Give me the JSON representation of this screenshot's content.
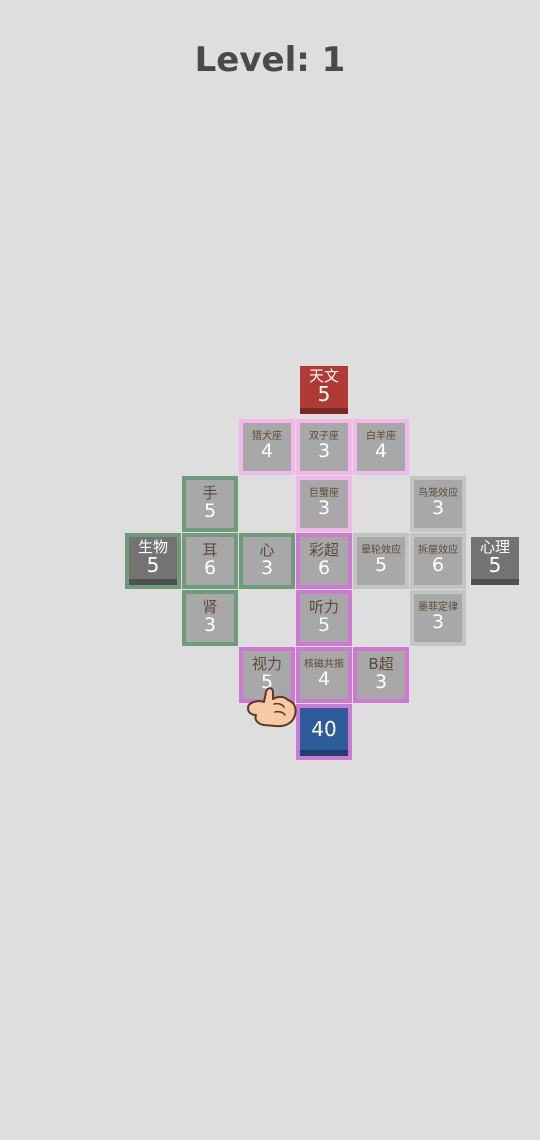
{
  "level_title": "Level: 1",
  "colors": {
    "background": "#dedede",
    "cell": "#a8a8a8",
    "astronomy": "#b03a36",
    "biology": "#737373",
    "psychology": "#737373",
    "player": "#2e5c9a",
    "pink_group": "#f2b8ea",
    "green_group": "#6f9a7c",
    "purple_group": "#cc7ad2",
    "grey_group": "#c4c4c4"
  },
  "frames": [
    {
      "id": "astronomy-zone",
      "color": "#f2b8ea",
      "cells": [
        [
          4,
          1
        ],
        [
          5,
          1
        ],
        [
          6,
          1
        ],
        [
          5,
          2
        ]
      ]
    },
    {
      "id": "biology-zone",
      "color": "#6f9a7c",
      "cells": [
        [
          3,
          2
        ],
        [
          2,
          3
        ],
        [
          3,
          3
        ],
        [
          4,
          3
        ],
        [
          3,
          4
        ]
      ]
    },
    {
      "id": "psychology-zone",
      "color": "#c4c4c4",
      "cells": [
        [
          7,
          2
        ],
        [
          6,
          3
        ],
        [
          7,
          3
        ],
        [
          7,
          4
        ]
      ]
    },
    {
      "id": "physics-zone",
      "color": "#cc7ad2",
      "cells": [
        [
          5,
          3
        ],
        [
          5,
          4
        ],
        [
          4,
          5
        ],
        [
          5,
          5
        ],
        [
          6,
          5
        ],
        [
          5,
          6
        ]
      ]
    }
  ],
  "categories": [
    {
      "id": "astronomy",
      "label": "天文",
      "value": "5",
      "col": 5,
      "row": 0,
      "color": "#b03a36"
    },
    {
      "id": "biology",
      "label": "生物",
      "value": "5",
      "col": 2,
      "row": 3,
      "color": "#737373"
    },
    {
      "id": "psychology",
      "label": "心理",
      "value": "5",
      "col": 8,
      "row": 3,
      "color": "#737373"
    }
  ],
  "cells": [
    {
      "id": "orion",
      "label": "猎犬座",
      "value": "4",
      "col": 4,
      "row": 1,
      "small": true
    },
    {
      "id": "gemini",
      "label": "双子座",
      "value": "3",
      "col": 5,
      "row": 1,
      "small": true
    },
    {
      "id": "aries",
      "label": "白羊座",
      "value": "4",
      "col": 6,
      "row": 1,
      "small": true
    },
    {
      "id": "hand",
      "label": "手",
      "value": "5",
      "col": 3,
      "row": 2
    },
    {
      "id": "cancer",
      "label": "巨蟹座",
      "value": "3",
      "col": 5,
      "row": 2,
      "small": true
    },
    {
      "id": "birdcage",
      "label": "鸟笼效应",
      "value": "3",
      "col": 7,
      "row": 2,
      "small": true
    },
    {
      "id": "ear",
      "label": "耳",
      "value": "6",
      "col": 3,
      "row": 3
    },
    {
      "id": "heart",
      "label": "心",
      "value": "3",
      "col": 4,
      "row": 3
    },
    {
      "id": "color-doppler",
      "label": "彩超",
      "value": "6",
      "col": 5,
      "row": 3
    },
    {
      "id": "halo-effect",
      "label": "晕轮效应",
      "value": "5",
      "col": 6,
      "row": 3,
      "small": true
    },
    {
      "id": "broken-window",
      "label": "拆屋效应",
      "value": "6",
      "col": 7,
      "row": 3,
      "small": true
    },
    {
      "id": "kidney",
      "label": "肾",
      "value": "3",
      "col": 3,
      "row": 4
    },
    {
      "id": "hearing",
      "label": "听力",
      "value": "5",
      "col": 5,
      "row": 4
    },
    {
      "id": "murphy",
      "label": "墨菲定律",
      "value": "3",
      "col": 7,
      "row": 4,
      "small": true
    },
    {
      "id": "vision",
      "label": "视力",
      "value": "5",
      "col": 4,
      "row": 5
    },
    {
      "id": "mri",
      "label": "核磁共振",
      "value": "4",
      "col": 5,
      "row": 5,
      "small": true
    },
    {
      "id": "b-ultrasound",
      "label": "B超",
      "value": "3",
      "col": 6,
      "row": 5
    }
  ],
  "player": {
    "value": "40",
    "col": 5,
    "row": 6,
    "color": "#2e5c9a"
  },
  "hand_icon": "pointing-hand-icon"
}
